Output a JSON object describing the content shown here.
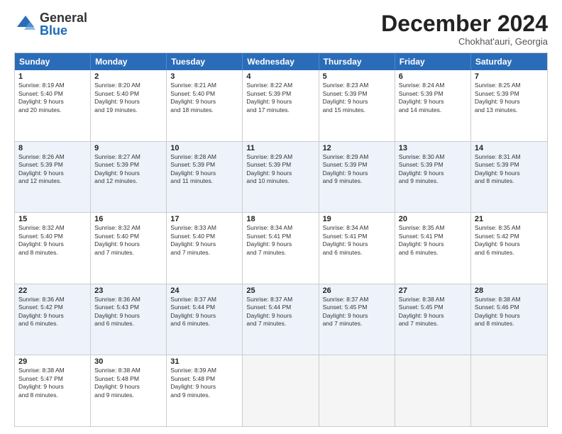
{
  "logo": {
    "general": "General",
    "blue": "Blue"
  },
  "title": "December 2024",
  "subtitle": "Chokhat'auri, Georgia",
  "days": [
    "Sunday",
    "Monday",
    "Tuesday",
    "Wednesday",
    "Thursday",
    "Friday",
    "Saturday"
  ],
  "weeks": [
    [
      {
        "day": "1",
        "sunrise": "8:19 AM",
        "sunset": "5:40 PM",
        "daylight": "9 hours and 20 minutes."
      },
      {
        "day": "2",
        "sunrise": "8:20 AM",
        "sunset": "5:40 PM",
        "daylight": "9 hours and 19 minutes."
      },
      {
        "day": "3",
        "sunrise": "8:21 AM",
        "sunset": "5:40 PM",
        "daylight": "9 hours and 18 minutes."
      },
      {
        "day": "4",
        "sunrise": "8:22 AM",
        "sunset": "5:39 PM",
        "daylight": "9 hours and 17 minutes."
      },
      {
        "day": "5",
        "sunrise": "8:23 AM",
        "sunset": "5:39 PM",
        "daylight": "9 hours and 15 minutes."
      },
      {
        "day": "6",
        "sunrise": "8:24 AM",
        "sunset": "5:39 PM",
        "daylight": "9 hours and 14 minutes."
      },
      {
        "day": "7",
        "sunrise": "8:25 AM",
        "sunset": "5:39 PM",
        "daylight": "9 hours and 13 minutes."
      }
    ],
    [
      {
        "day": "8",
        "sunrise": "8:26 AM",
        "sunset": "5:39 PM",
        "daylight": "9 hours and 12 minutes."
      },
      {
        "day": "9",
        "sunrise": "8:27 AM",
        "sunset": "5:39 PM",
        "daylight": "9 hours and 12 minutes."
      },
      {
        "day": "10",
        "sunrise": "8:28 AM",
        "sunset": "5:39 PM",
        "daylight": "9 hours and 11 minutes."
      },
      {
        "day": "11",
        "sunrise": "8:29 AM",
        "sunset": "5:39 PM",
        "daylight": "9 hours and 10 minutes."
      },
      {
        "day": "12",
        "sunrise": "8:29 AM",
        "sunset": "5:39 PM",
        "daylight": "9 hours and 9 minutes."
      },
      {
        "day": "13",
        "sunrise": "8:30 AM",
        "sunset": "5:39 PM",
        "daylight": "9 hours and 9 minutes."
      },
      {
        "day": "14",
        "sunrise": "8:31 AM",
        "sunset": "5:39 PM",
        "daylight": "9 hours and 8 minutes."
      }
    ],
    [
      {
        "day": "15",
        "sunrise": "8:32 AM",
        "sunset": "5:40 PM",
        "daylight": "9 hours and 8 minutes."
      },
      {
        "day": "16",
        "sunrise": "8:32 AM",
        "sunset": "5:40 PM",
        "daylight": "9 hours and 7 minutes."
      },
      {
        "day": "17",
        "sunrise": "8:33 AM",
        "sunset": "5:40 PM",
        "daylight": "9 hours and 7 minutes."
      },
      {
        "day": "18",
        "sunrise": "8:34 AM",
        "sunset": "5:41 PM",
        "daylight": "9 hours and 7 minutes."
      },
      {
        "day": "19",
        "sunrise": "8:34 AM",
        "sunset": "5:41 PM",
        "daylight": "9 hours and 6 minutes."
      },
      {
        "day": "20",
        "sunrise": "8:35 AM",
        "sunset": "5:41 PM",
        "daylight": "9 hours and 6 minutes."
      },
      {
        "day": "21",
        "sunrise": "8:35 AM",
        "sunset": "5:42 PM",
        "daylight": "9 hours and 6 minutes."
      }
    ],
    [
      {
        "day": "22",
        "sunrise": "8:36 AM",
        "sunset": "5:42 PM",
        "daylight": "9 hours and 6 minutes."
      },
      {
        "day": "23",
        "sunrise": "8:36 AM",
        "sunset": "5:43 PM",
        "daylight": "9 hours and 6 minutes."
      },
      {
        "day": "24",
        "sunrise": "8:37 AM",
        "sunset": "5:44 PM",
        "daylight": "9 hours and 6 minutes."
      },
      {
        "day": "25",
        "sunrise": "8:37 AM",
        "sunset": "5:44 PM",
        "daylight": "9 hours and 7 minutes."
      },
      {
        "day": "26",
        "sunrise": "8:37 AM",
        "sunset": "5:45 PM",
        "daylight": "9 hours and 7 minutes."
      },
      {
        "day": "27",
        "sunrise": "8:38 AM",
        "sunset": "5:45 PM",
        "daylight": "9 hours and 7 minutes."
      },
      {
        "day": "28",
        "sunrise": "8:38 AM",
        "sunset": "5:46 PM",
        "daylight": "9 hours and 8 minutes."
      }
    ],
    [
      {
        "day": "29",
        "sunrise": "8:38 AM",
        "sunset": "5:47 PM",
        "daylight": "9 hours and 8 minutes."
      },
      {
        "day": "30",
        "sunrise": "8:38 AM",
        "sunset": "5:48 PM",
        "daylight": "9 hours and 9 minutes."
      },
      {
        "day": "31",
        "sunrise": "8:39 AM",
        "sunset": "5:48 PM",
        "daylight": "9 hours and 9 minutes."
      },
      null,
      null,
      null,
      null
    ]
  ]
}
